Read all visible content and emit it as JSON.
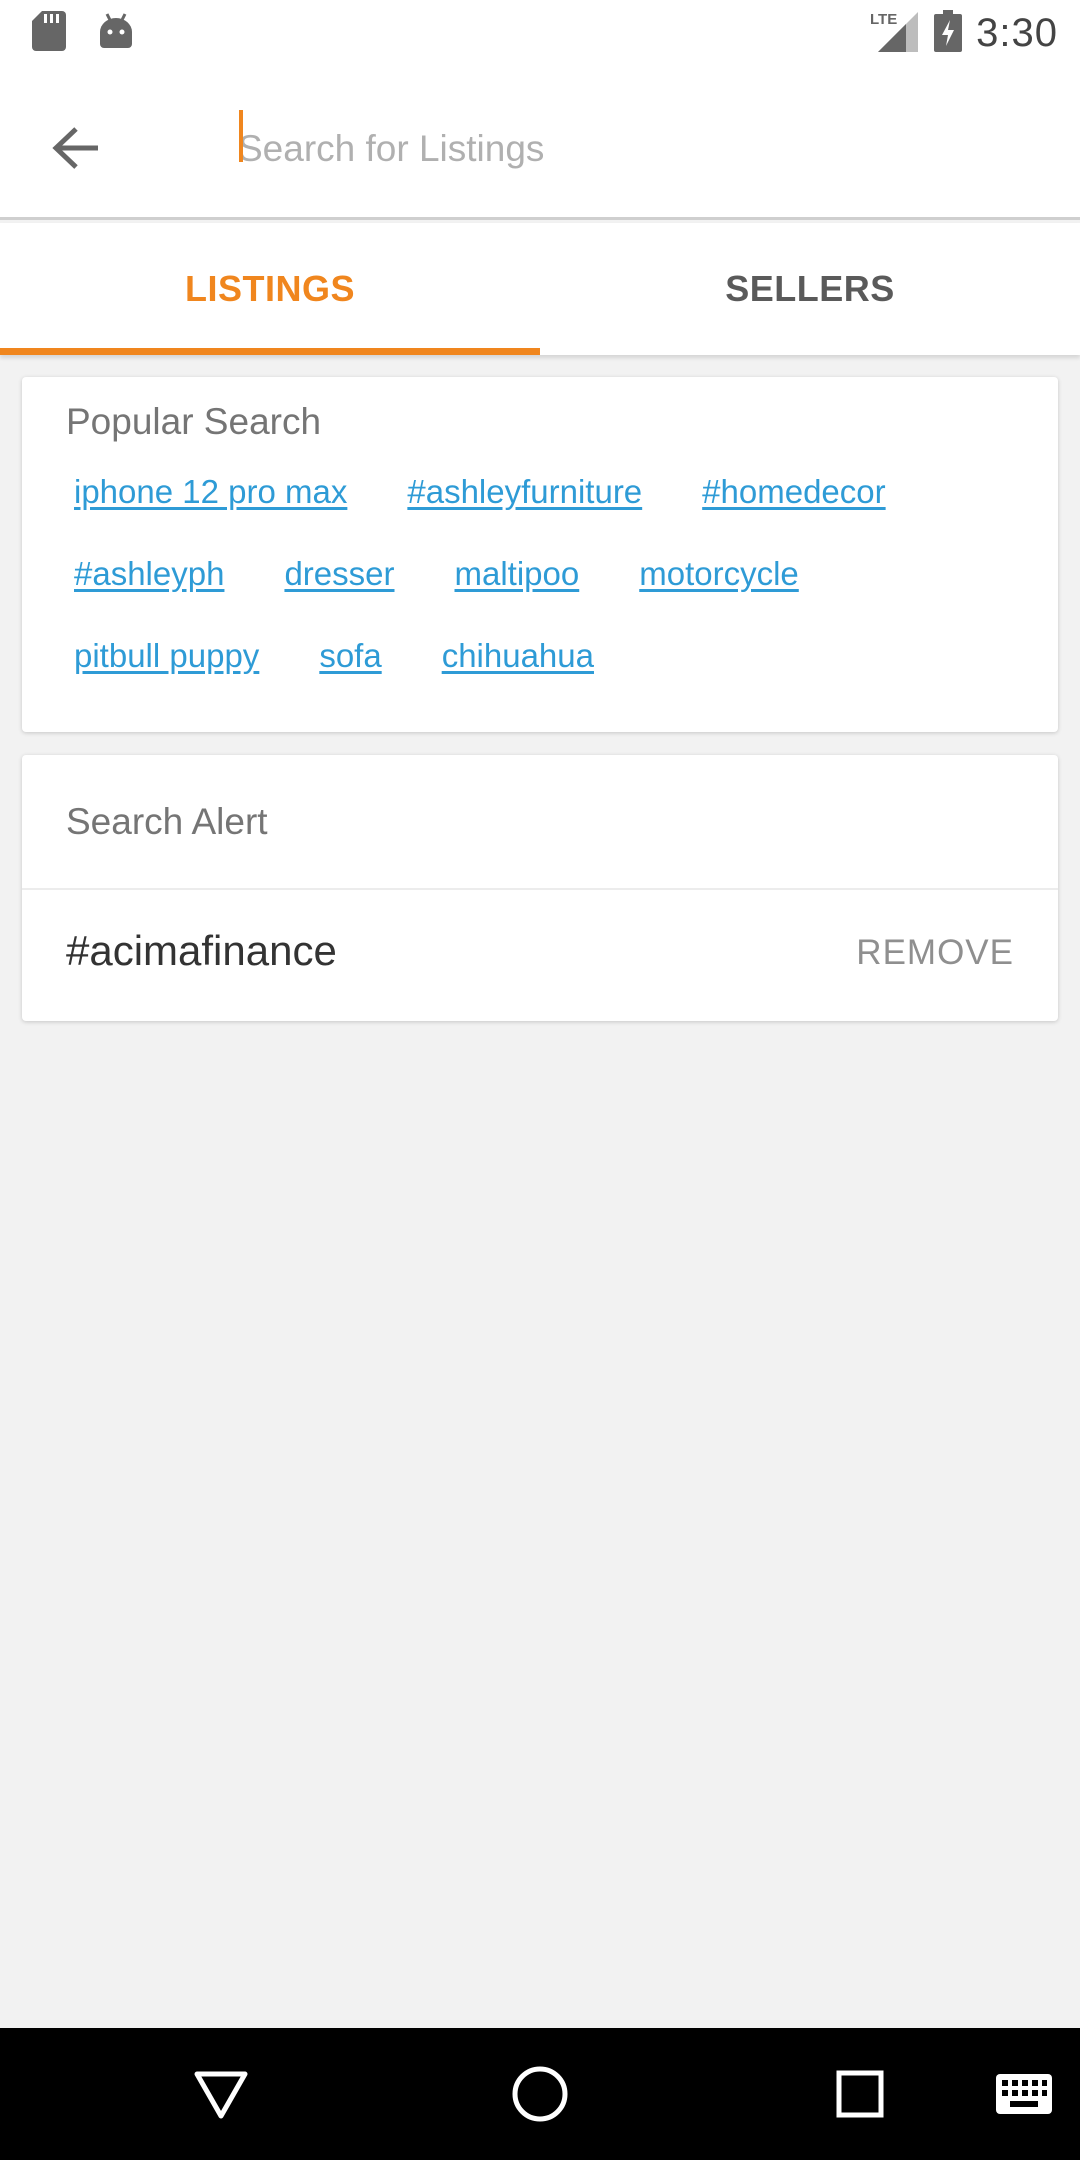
{
  "status_bar": {
    "time": "3:30",
    "network": "LTE",
    "icons": [
      "sd-card-icon",
      "android-icon",
      "signal-icon",
      "battery-charging-icon"
    ]
  },
  "search": {
    "placeholder": "Search for Listings",
    "value": ""
  },
  "tabs": [
    {
      "label": "LISTINGS",
      "active": true
    },
    {
      "label": "SELLERS",
      "active": false
    }
  ],
  "popular_search": {
    "title": "Popular Search",
    "rows": [
      [
        "iphone 12 pro max",
        "#ashleyfurniture",
        "#homedecor"
      ],
      [
        "#ashleyph",
        "dresser",
        "maltipoo",
        "motorcycle"
      ],
      [
        "pitbull puppy",
        "sofa",
        "chihuahua"
      ]
    ]
  },
  "search_alert": {
    "title": "Search Alert",
    "items": [
      {
        "term": "#acimafinance",
        "action": "REMOVE"
      }
    ]
  },
  "colors": {
    "accent": "#f0861e",
    "link": "#2e9bd6",
    "background": "#f2f2f2"
  }
}
